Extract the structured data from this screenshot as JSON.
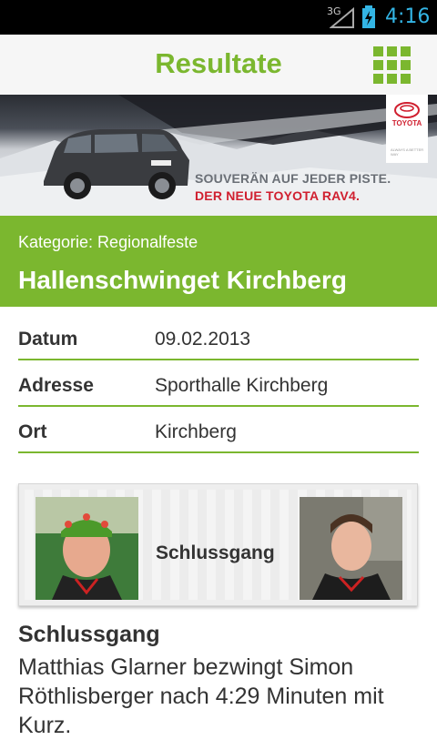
{
  "status_bar": {
    "network": "3G",
    "time": "4:16",
    "accent_color": "#33b5e5"
  },
  "app_bar": {
    "title": "Resultate",
    "menu_icon": "grid-icon",
    "accent_color": "#7bb72f"
  },
  "ad": {
    "brand": "TOYOTA",
    "tagline_small": "ALWAYS A BETTER WAY",
    "slogan_line1": "SOUVERÄN AUF JEDER PISTE.",
    "slogan_line2": "DER NEUE TOYOTA RAV4."
  },
  "event": {
    "category": "Kategorie: Regionalfeste",
    "title": "Hallenschwinget Kirchberg"
  },
  "details": [
    {
      "label": "Datum",
      "value": "09.02.2013"
    },
    {
      "label": "Adresse",
      "value": "Sporthalle Kirchberg"
    },
    {
      "label": "Ort",
      "value": "Kirchberg"
    }
  ],
  "final_card": {
    "label": "Schlussgang",
    "left_photo": "winner-photo",
    "right_photo": "opponent-photo"
  },
  "report": {
    "title": "Schlussgang",
    "text": "Matthias Glarner bezwingt Simon Röthlisberger nach 4:29 Minuten mit Kurz."
  }
}
